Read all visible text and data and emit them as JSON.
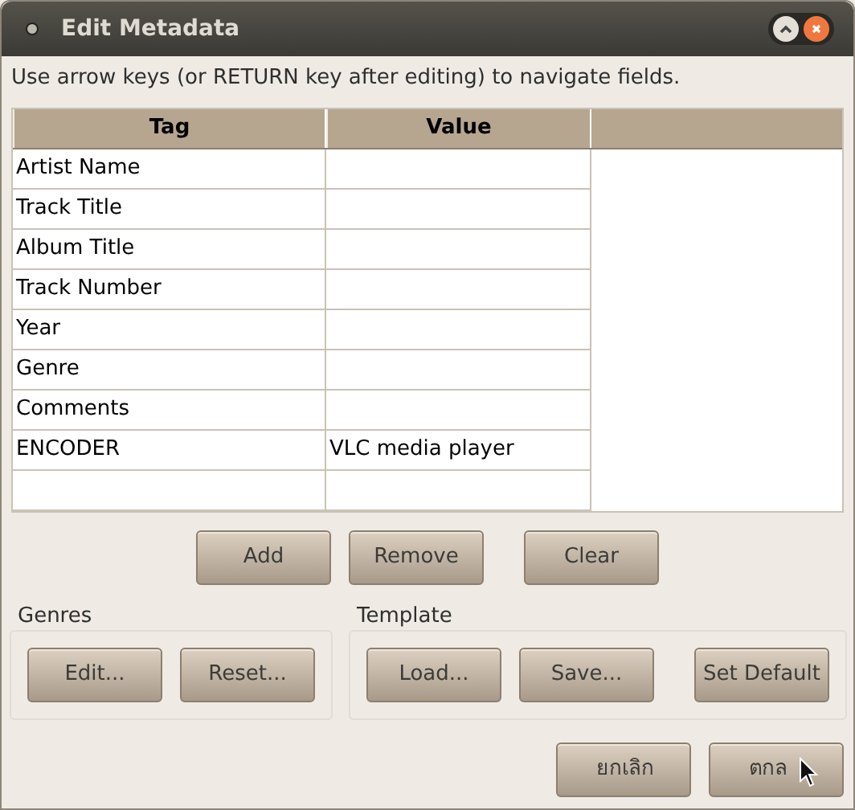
{
  "window": {
    "title": "Edit Metadata"
  },
  "instruction": "Use arrow keys (or RETURN key after editing) to navigate fields.",
  "table": {
    "columns": [
      "Tag",
      "Value"
    ],
    "rows": [
      {
        "tag": "Artist Name"
      },
      {
        "tag": "Track Title"
      },
      {
        "tag": "Album Title"
      },
      {
        "tag": "Track Number"
      },
      {
        "tag": "Year"
      },
      {
        "tag": "Genre"
      },
      {
        "tag": "Comments"
      },
      {
        "tag": "ENCODER",
        "value": "VLC media player"
      }
    ]
  },
  "row_buttons": [
    "Add",
    "Remove",
    "Clear"
  ],
  "genres": {
    "label": "Genres",
    "buttons": [
      "Edit...",
      "Reset..."
    ]
  },
  "template": {
    "label": "Template",
    "buttons": [
      "Load...",
      "Save...",
      "Set Default"
    ]
  },
  "dialog_buttons": [
    "ยกเลิก",
    "ตกล"
  ]
}
